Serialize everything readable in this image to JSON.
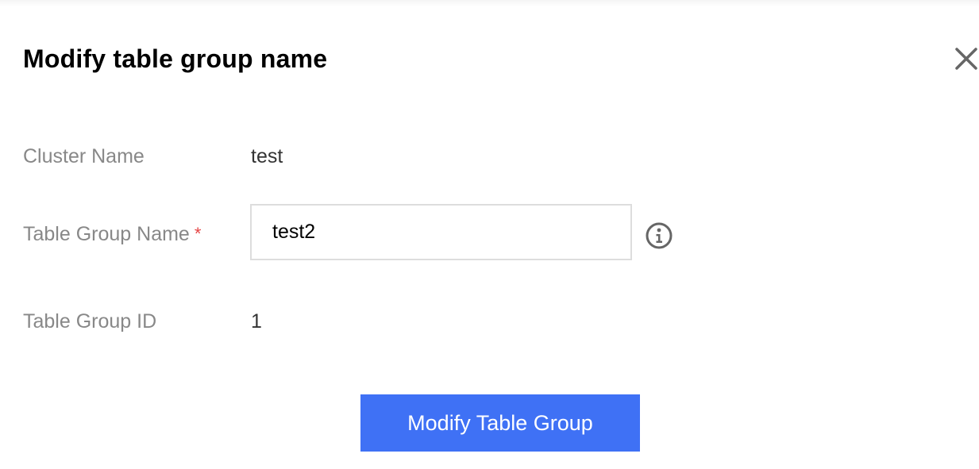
{
  "dialog": {
    "title": "Modify table group name",
    "close_icon": "close-icon"
  },
  "form": {
    "cluster_name": {
      "label": "Cluster Name",
      "value": "test"
    },
    "table_group_name": {
      "label": "Table Group Name",
      "required_mark": "*",
      "value": "test2",
      "info_icon": "info-icon"
    },
    "table_group_id": {
      "label": "Table Group ID",
      "value": "1"
    }
  },
  "actions": {
    "submit_label": "Modify Table Group"
  },
  "colors": {
    "primary": "#3f71f5",
    "required": "#e54545",
    "label": "#888888",
    "input_border": "#dddddd"
  }
}
